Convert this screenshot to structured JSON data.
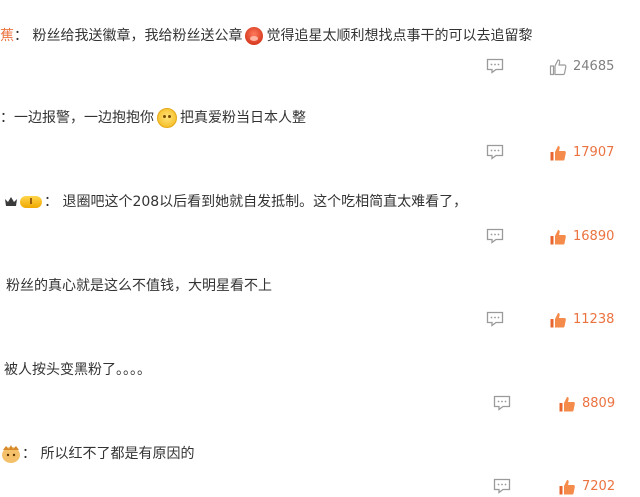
{
  "comments": [
    {
      "prefix": "蕉",
      "text1": "：  粉丝给我送徽章，我给粉丝送公章",
      "emoji": "pig-emoji",
      "text2": "觉得追星太顺利想找点事干的可以去追留黎",
      "likes": "24685",
      "like_style": "plain"
    },
    {
      "prefix": "",
      "text1": "：一边报警，一边抱抱你",
      "emoji": "hug-emoji",
      "text2": "把真爱粉当日本人整",
      "likes": "17907",
      "like_style": "hot"
    },
    {
      "prefix": "",
      "text1": "：  退圈吧这个208以后看到她就自发抵制。这个吃相简直太难看了，",
      "emoji": "",
      "text2": "",
      "likes": "16890",
      "like_style": "hot",
      "badge_level": "I"
    },
    {
      "prefix": "",
      "text1": "粉丝的真心就是这么不值钱，大明星看不上",
      "emoji": "",
      "text2": "",
      "likes": "11238",
      "like_style": "hot"
    },
    {
      "prefix": "",
      "text1": "被人按头变黑粉了。。。。",
      "emoji": "",
      "text2": "",
      "likes": "8809",
      "like_style": "hot"
    },
    {
      "prefix": "",
      "text1": "：  所以红不了都是有原因的",
      "emoji": "",
      "text2": "",
      "likes": "7202",
      "like_style": "hot"
    }
  ],
  "colors": {
    "text": "#333333",
    "hot_like": "#eb7340",
    "plain_like": "#808080",
    "icon": "#9a9a9a"
  }
}
